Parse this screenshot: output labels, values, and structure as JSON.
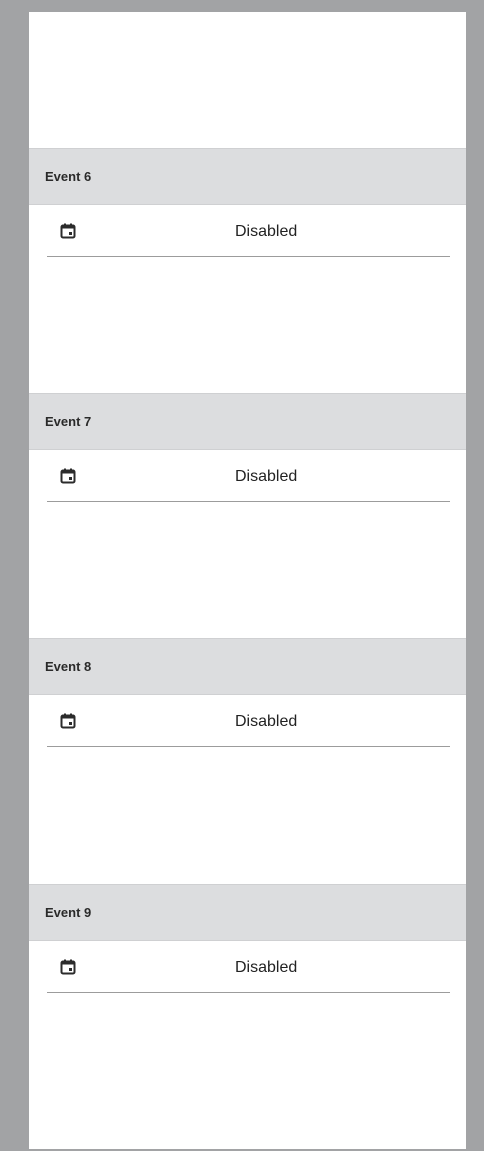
{
  "events": [
    {
      "title": "Event 6",
      "status": "Disabled",
      "icon": "calendar-icon"
    },
    {
      "title": "Event 7",
      "status": "Disabled",
      "icon": "calendar-icon"
    },
    {
      "title": "Event 8",
      "status": "Disabled",
      "icon": "calendar-icon"
    },
    {
      "title": "Event 9",
      "status": "Disabled",
      "icon": "calendar-icon"
    }
  ],
  "colors": {
    "frame": "#a2a3a5",
    "header_bg": "#dcdddf",
    "panel_bg": "#ffffff",
    "divider": "#9c9c9c"
  }
}
